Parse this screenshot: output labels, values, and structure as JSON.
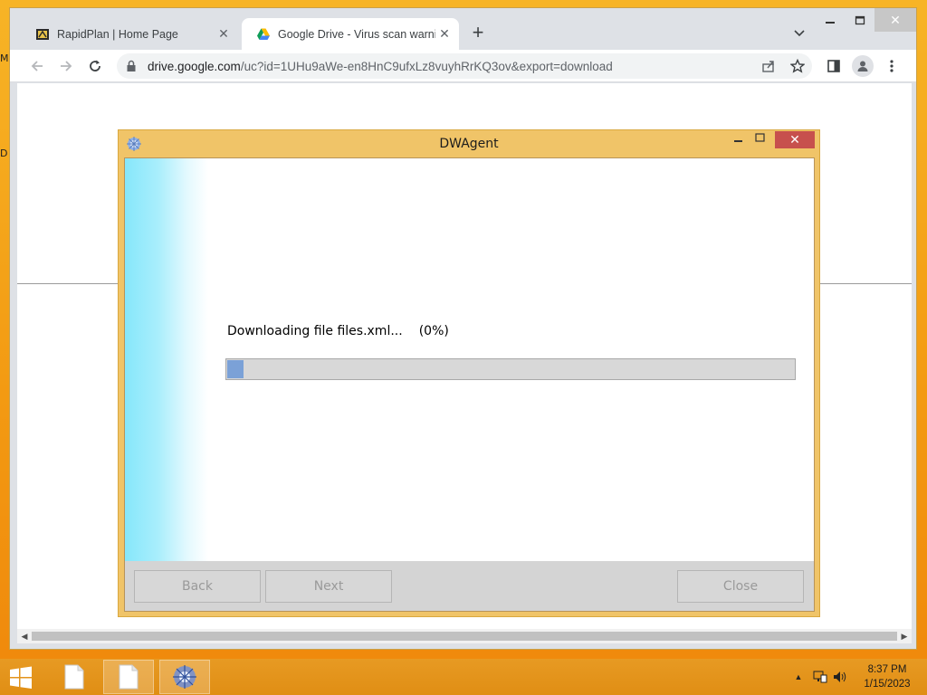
{
  "desktop": {
    "edge_labels": [
      "M",
      "D"
    ]
  },
  "browser": {
    "tabs": [
      {
        "title": "RapidPlan | Home Page",
        "icon": "rapidplan-favicon",
        "active": false
      },
      {
        "title": "Google Drive - Virus scan warnin",
        "icon": "google-drive-icon",
        "active": true
      }
    ],
    "new_tab_label": "+",
    "url_host": "drive.google.com",
    "url_path": "/uc?id=1UHu9aWe-en8HnC9ufxLz8vuyhRrKQ3ov&export=download"
  },
  "dialog": {
    "title": "DWAgent",
    "status_text": "Downloading file files.xml...",
    "progress_text": "(0%)",
    "progress_value": 0,
    "buttons": {
      "back": "Back",
      "next": "Next",
      "close": "Close"
    }
  },
  "taskbar": {
    "time": "8:37 PM",
    "date": "1/15/2023"
  },
  "colors": {
    "desktop_accent": "#f6a41e",
    "dialog_frame": "#f0c468",
    "dialog_close": "#c7504d",
    "progress_fill": "#7ba1d7"
  }
}
